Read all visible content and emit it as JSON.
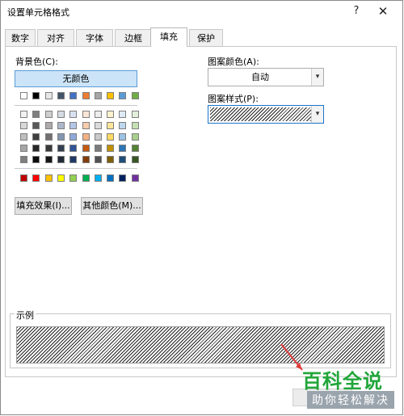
{
  "window": {
    "title": "设置单元格格式",
    "help_glyph": "?",
    "close_glyph": "✕"
  },
  "tabs": [
    {
      "label": "数字",
      "active": false
    },
    {
      "label": "对齐",
      "active": false
    },
    {
      "label": "字体",
      "active": false
    },
    {
      "label": "边框",
      "active": false
    },
    {
      "label": "填充",
      "active": true
    },
    {
      "label": "保护",
      "active": false
    }
  ],
  "fill": {
    "background_label": "背景色(C):",
    "no_color_label": "无颜色",
    "fill_effects_label": "填充效果(I)...",
    "more_colors_label": "其他颜色(M)..."
  },
  "palette": {
    "top_row": [
      "#ffffff",
      "#000000",
      "#e7e6e6",
      "#44546a",
      "#4472c4",
      "#ed7d31",
      "#a5a5a5",
      "#ffc000",
      "#5b9bd5",
      "#70ad47"
    ],
    "tint_rows": [
      [
        "#f2f2f2",
        "#7f7f7f",
        "#d0cece",
        "#d6dce4",
        "#d9e2f3",
        "#fbe5d5",
        "#ededed",
        "#fff2cc",
        "#deebf6",
        "#e2efd9"
      ],
      [
        "#d8d8d8",
        "#595959",
        "#aeaaaa",
        "#adb9ca",
        "#b4c6e7",
        "#f7cbac",
        "#dbdbdb",
        "#fee599",
        "#bdd7ee",
        "#c5e0b3"
      ],
      [
        "#bfbfbf",
        "#3f3f3f",
        "#757070",
        "#8496b0",
        "#8eaadb",
        "#f4b183",
        "#c9c9c9",
        "#ffd965",
        "#9cc3e5",
        "#a8d08d"
      ],
      [
        "#a5a5a5",
        "#262626",
        "#3a3838",
        "#323f4f",
        "#2f5496",
        "#c55a11",
        "#7b7b7b",
        "#bf9000",
        "#2e75b5",
        "#538135"
      ],
      [
        "#7f7f7f",
        "#0c0c0c",
        "#171616",
        "#222a35",
        "#1f3864",
        "#833c0b",
        "#525252",
        "#7f6000",
        "#1e4e79",
        "#375623"
      ]
    ],
    "standard_row": [
      "#c00000",
      "#ff0000",
      "#ffc000",
      "#ffff00",
      "#92d050",
      "#00b050",
      "#00b0f0",
      "#0070c0",
      "#002060",
      "#7030a0"
    ]
  },
  "pattern": {
    "color_label": "图案颜色(A):",
    "color_value": "自动",
    "style_label": "图案样式(P):"
  },
  "sample": {
    "label": "示例"
  },
  "watermark": {
    "main": "百科全说",
    "sub": "助你轻松解决"
  }
}
